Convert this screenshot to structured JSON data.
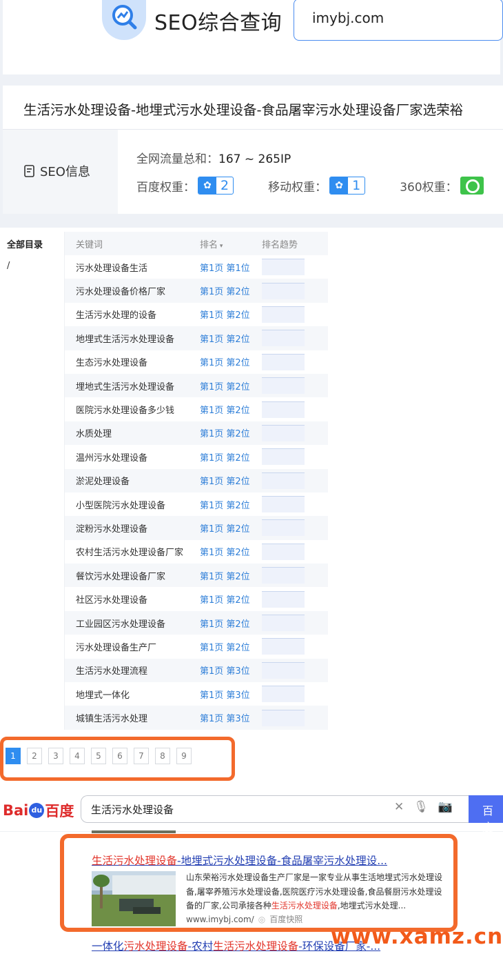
{
  "header": {
    "app_title": "SEO综合查询",
    "domain_value": "imybj.com"
  },
  "site": {
    "title": "生活污水处理设备-地埋式污水处理设备-食品屠宰污水处理设备厂家选荣裕",
    "seo_info_label": "SEO信息",
    "traffic_label": "全网流量总和：",
    "traffic_value": "167 ~ 265IP",
    "baidu_weight_label": "百度权重：",
    "baidu_weight_value": "2",
    "mobile_weight_label": "移动权重：",
    "mobile_weight_value": "1",
    "weight360_label": "360权重："
  },
  "keywords": {
    "sidebar_all": "全部目录",
    "sidebar_root": "/",
    "columns": {
      "keyword": "关键词",
      "rank": "排名",
      "trend": "排名趋势"
    },
    "rows": [
      {
        "keyword": "污水处理设备生活",
        "rank": "第1页 第1位"
      },
      {
        "keyword": "污水处理设备价格厂家",
        "rank": "第1页 第2位"
      },
      {
        "keyword": "生活污水处理的设备",
        "rank": "第1页 第2位"
      },
      {
        "keyword": "地埋式生活污水处理设备",
        "rank": "第1页 第2位"
      },
      {
        "keyword": "生态污水处理设备",
        "rank": "第1页 第2位"
      },
      {
        "keyword": "埋地式生活污水处理设备",
        "rank": "第1页 第2位"
      },
      {
        "keyword": "医院污水处理设备多少钱",
        "rank": "第1页 第2位"
      },
      {
        "keyword": "水质处理",
        "rank": "第1页 第2位"
      },
      {
        "keyword": "温州污水处理设备",
        "rank": "第1页 第2位"
      },
      {
        "keyword": "淤泥处理设备",
        "rank": "第1页 第2位"
      },
      {
        "keyword": "小型医院污水处理设备",
        "rank": "第1页 第2位"
      },
      {
        "keyword": "淀粉污水处理设备",
        "rank": "第1页 第2位"
      },
      {
        "keyword": "农村生活污水处理设备厂家",
        "rank": "第1页 第2位"
      },
      {
        "keyword": "餐饮污水处理设备厂家",
        "rank": "第1页 第2位"
      },
      {
        "keyword": "社区污水处理设备",
        "rank": "第1页 第2位"
      },
      {
        "keyword": "工业园区污水处理设备",
        "rank": "第1页 第2位"
      },
      {
        "keyword": "污水处理设备生产厂",
        "rank": "第1页 第2位"
      },
      {
        "keyword": "生活污水处理流程",
        "rank": "第1页 第3位"
      },
      {
        "keyword": "地埋式一体化",
        "rank": "第1页 第3位"
      },
      {
        "keyword": "城镇生活污水处理",
        "rank": "第1页 第3位"
      }
    ],
    "pages": [
      "1",
      "2",
      "3",
      "4",
      "5",
      "6",
      "7",
      "8",
      "9"
    ]
  },
  "baidu": {
    "logo_left": "Bai",
    "logo_paw": "du",
    "logo_right": "百度",
    "query": "生活污水处理设备",
    "button": "百度",
    "result1": {
      "title_red": "生活污水处理设备",
      "title_rest": "-地埋式污水处理设备-食品屠宰污水处理设...",
      "desc_line1": "山东荣裕污水处理设备生产厂家是一家专业从事生活地埋式污水处理设",
      "desc_line2": "备,屠宰养殖污水处理设备,医院医疗污水处理设备,食品餐厨污水处理设",
      "desc_line3_a": "备的厂家,公司承接各种",
      "desc_line3_red": "生活污水处理设备",
      "desc_line3_b": ",地埋式污水处理...",
      "url": "www.imybj.com/",
      "snapshot": "百度快照"
    },
    "result2": {
      "part1": "一体化",
      "part2": "污水处理设备",
      "part3": "-农村",
      "part4": "生活污水处理设备",
      "part5": "-环保设备厂家-..."
    }
  },
  "watermark": "www.xamz.cn",
  "colors": {
    "accent_blue": "#2f8df0",
    "highlight_orange": "#f36a2c",
    "baidu_link": "#2440b3",
    "baidu_red": "#e2342a"
  }
}
